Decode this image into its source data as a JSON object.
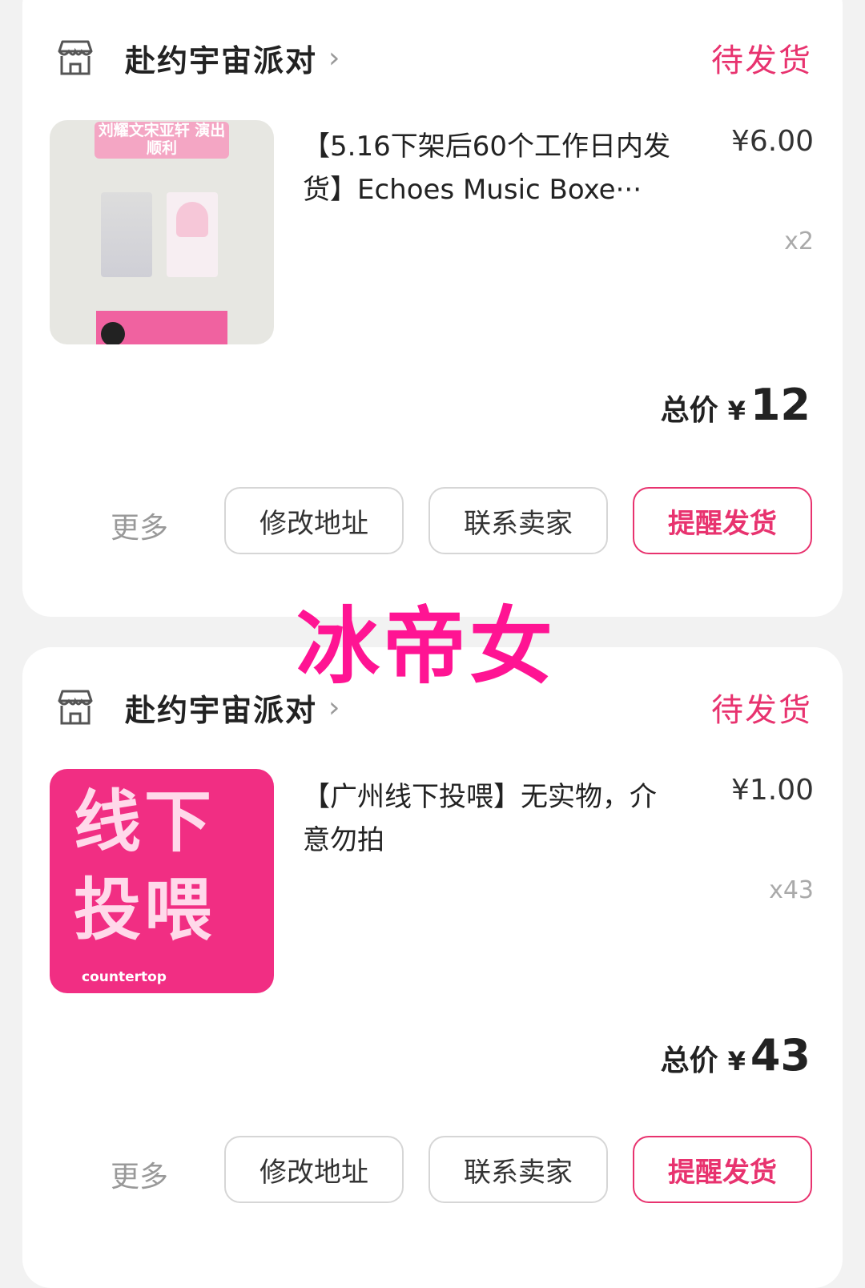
{
  "colors": {
    "accent": "#e8336f",
    "watermark": "#ff1493",
    "background": "#f2f2f2"
  },
  "watermark": "冰帝女",
  "orders": [
    {
      "shop": {
        "name": "赴约宇宙派对",
        "icon": "store-icon",
        "chevron": "›"
      },
      "status": "待发货",
      "item": {
        "title": "【5.16下架后60个工作日内发货】Echoes Music Boxe···",
        "price": "¥6.00",
        "qty": "x2",
        "thumb_banner": "刘耀文宋亚轩 演出顺利"
      },
      "total": {
        "label": "总价",
        "currency": "¥",
        "amount": "12"
      },
      "actions": {
        "more": "更多",
        "change_address": "修改地址",
        "contact_seller": "联系卖家",
        "remind_ship": "提醒发货"
      }
    },
    {
      "shop": {
        "name": "赴约宇宙派对",
        "icon": "store-icon",
        "chevron": "›"
      },
      "status": "待发货",
      "item": {
        "title": "【广州线下投喂】无实物，介意勿拍",
        "price": "¥1.00",
        "qty": "x43",
        "thumb_text_line1": "线下",
        "thumb_text_line2": "投喂",
        "thumb_brand": "countertop"
      },
      "total": {
        "label": "总价",
        "currency": "¥",
        "amount": "43"
      },
      "actions": {
        "more": "更多",
        "change_address": "修改地址",
        "contact_seller": "联系卖家",
        "remind_ship": "提醒发货"
      }
    }
  ]
}
